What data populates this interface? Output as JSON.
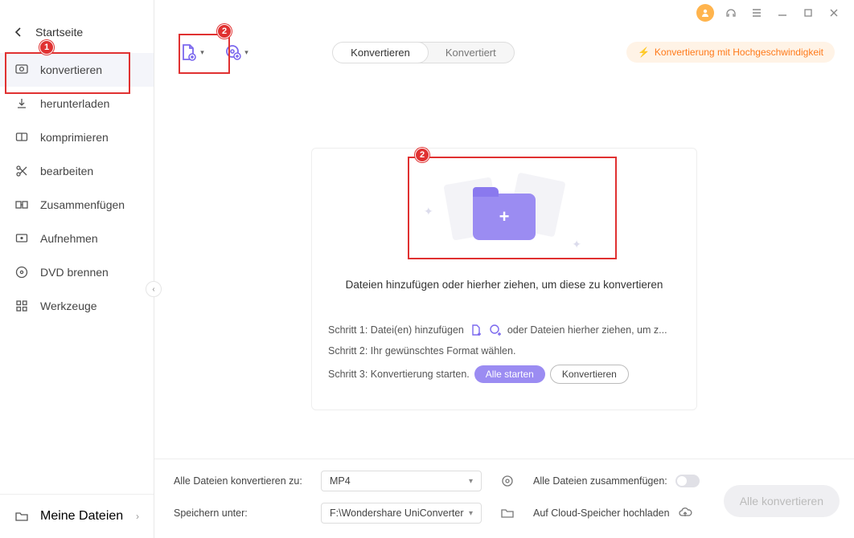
{
  "annotations": {
    "badge1": "1",
    "badge2": "2",
    "badge3": "2"
  },
  "sidebar": {
    "title": "Startseite",
    "items": [
      {
        "label": "konvertieren"
      },
      {
        "label": "herunterladen"
      },
      {
        "label": "komprimieren"
      },
      {
        "label": "bearbeiten"
      },
      {
        "label": "Zusammenfügen"
      },
      {
        "label": "Aufnehmen"
      },
      {
        "label": "DVD brennen"
      },
      {
        "label": "Werkzeuge"
      }
    ],
    "my_files": "Meine Dateien"
  },
  "tabs": {
    "convert": "Konvertieren",
    "converted": "Konvertiert"
  },
  "highspeed": "Konvertierung mit Hochgeschwindigkeit",
  "dropzone": {
    "main_text": "Dateien hinzufügen oder hierher ziehen, um diese zu konvertieren",
    "step1_prefix": "Schritt 1: Datei(en) hinzufügen",
    "step1_suffix": "oder Dateien hierher ziehen, um z...",
    "step2": "Schritt 2: Ihr gewünschtes Format wählen.",
    "step3": "Schritt 3: Konvertierung starten.",
    "start_all": "Alle starten",
    "convert_btn": "Konvertieren"
  },
  "bottom": {
    "convert_all_to": "Alle Dateien konvertieren zu:",
    "format_value": "MP4",
    "save_under": "Speichern unter:",
    "save_path": "F:\\Wondershare UniConverter",
    "merge_label": "Alle Dateien zusammenfügen:",
    "cloud_label": "Auf Cloud-Speicher hochladen",
    "convert_all_btn": "Alle konvertieren"
  }
}
